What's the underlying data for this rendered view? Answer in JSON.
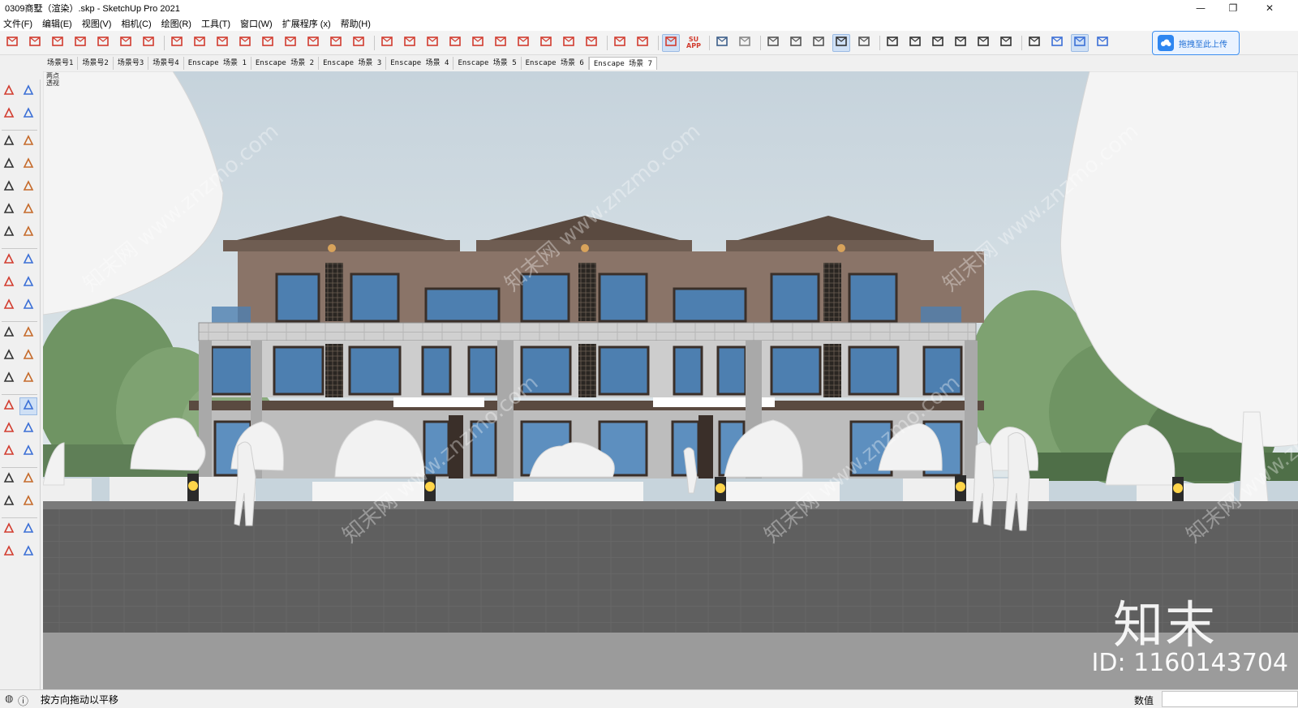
{
  "window": {
    "title": "0309商墅（渲染）.skp - SketchUp Pro 2021",
    "controls": {
      "minimize": "—",
      "maximize": "❐",
      "close": "✕"
    }
  },
  "menubar": {
    "items": [
      "文件(F)",
      "编辑(E)",
      "视图(V)",
      "相机(C)",
      "绘图(R)",
      "工具(T)",
      "窗口(W)",
      "扩展程序 (x)",
      "帮助(H)"
    ]
  },
  "toolbar": {
    "upload_label": "拖拽至此上传",
    "su_app_label": "SU APP"
  },
  "scene_tabs": [
    "场景号1",
    "场景号2",
    "场景号3",
    "场景号4",
    "Enscape 场景 1",
    "Enscape 场景 2",
    "Enscape 场景 3",
    "Enscape 场景 4",
    "Enscape 场景 5",
    "Enscape 场景 6",
    "Enscape 场景 7"
  ],
  "active_scene_index": 10,
  "viewport": {
    "camera_label_line1": "两点",
    "camera_label_line2": "透视",
    "watermark_logo": "知末",
    "watermark_id": "ID: 1160143704",
    "watermark_repeat": "知末网 www.znzmo.com"
  },
  "statusbar": {
    "info_icon": "ⓘ",
    "hint": "按方向拖动以平移",
    "measurement_label": "数值",
    "measurement_value": ""
  },
  "colors": {
    "sky": "#c9d6de",
    "facade_stone": "#cfcfcf",
    "facade_brown": "#8a7468",
    "glass": "#4d7fb0",
    "ground": "#5e5e5e",
    "accent_blue": "#2e86f0"
  }
}
